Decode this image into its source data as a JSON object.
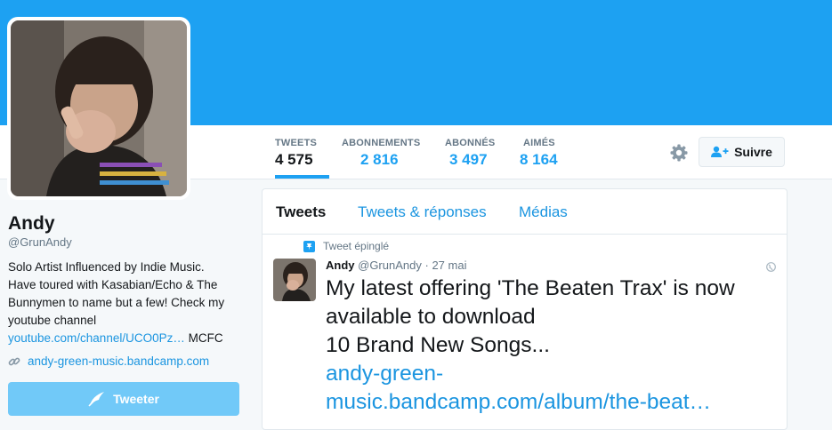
{
  "profile": {
    "name": "Andy",
    "handle": "@GrunAndy",
    "bio_lines": [
      "Solo Artist Influenced by Indie Music.",
      "Have toured with Kasabian/Echo & The",
      "Bunnymen to name but a few! Check my",
      "youtube channel"
    ],
    "bio_link": "youtube.com/channel/UCO0Pz…",
    "bio_suffix": " MCFC",
    "website": "andy-green-music.bandcamp.com",
    "tweet_button": "Tweeter"
  },
  "stats": [
    {
      "label": "TWEETS",
      "value": "4 575"
    },
    {
      "label": "ABONNEMENTS",
      "value": "2 816"
    },
    {
      "label": "ABONNÉS",
      "value": "3 497"
    },
    {
      "label": "AIMÉS",
      "value": "8 164"
    }
  ],
  "actions": {
    "follow": "Suivre",
    "settings_icon": "gear-icon"
  },
  "timeline": {
    "tabs": [
      "Tweets",
      "Tweets & réponses",
      "Médias"
    ],
    "pinned_label": "Tweet épinglé",
    "tweet": {
      "name": "Andy",
      "handle": "@GrunAndy",
      "separator": "·",
      "date": "27 mai",
      "text_lines": [
        "My latest offering 'The Beaten Trax' is now",
        "available to download",
        "10 Brand New Songs..."
      ],
      "link_lines": [
        "andy-green-",
        "music.bandcamp.com/album/the-beat…"
      ]
    }
  },
  "colors": {
    "header": "#1da1f2",
    "link": "#1b95e0",
    "tweet_button": "#71c9f8",
    "muted": "#657786"
  }
}
